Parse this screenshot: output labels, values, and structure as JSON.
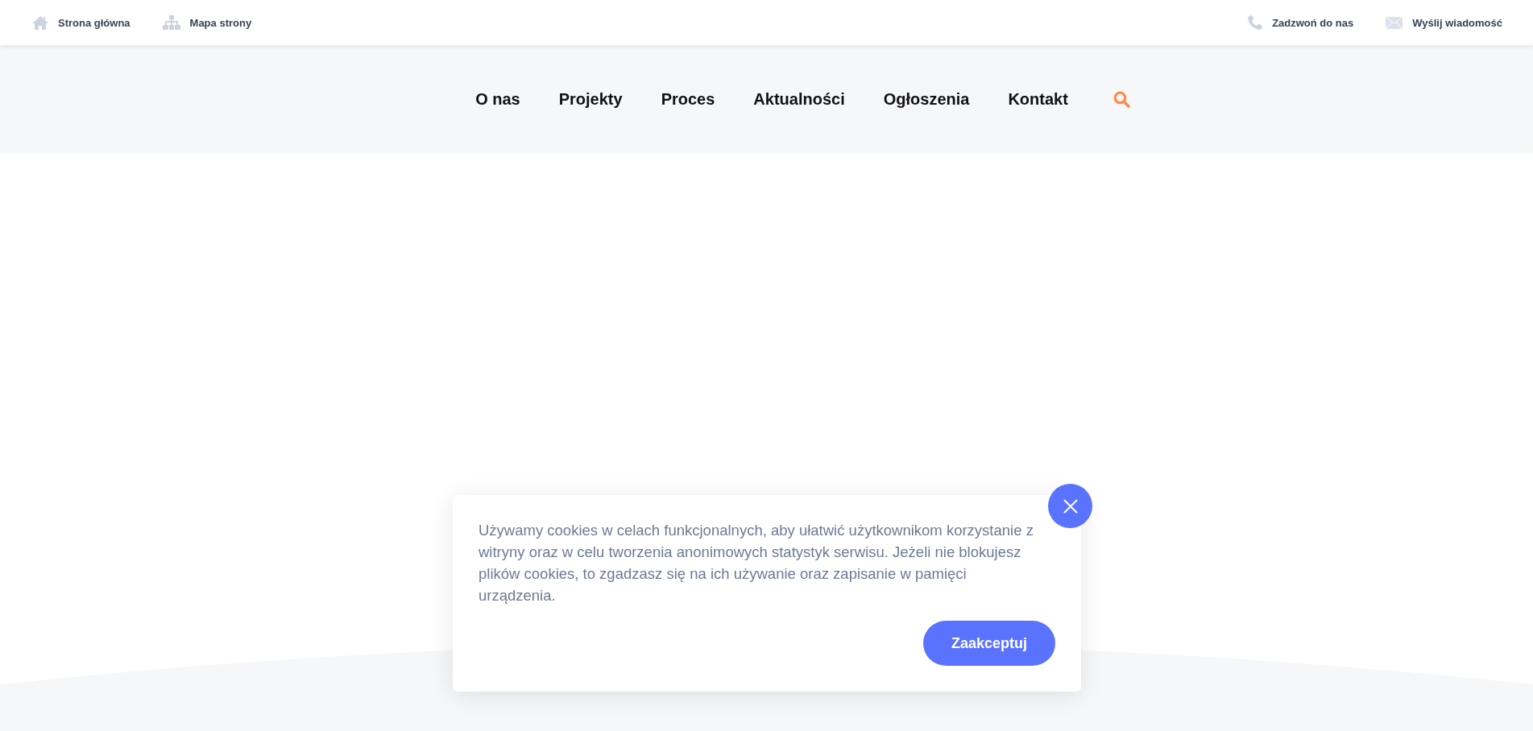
{
  "top_bar": {
    "left_links": [
      {
        "kind": "home",
        "label": "Strona główna"
      },
      {
        "kind": "sitemap",
        "label": "Mapa strony"
      }
    ],
    "right_links": [
      {
        "kind": "phone",
        "label": "Zadzwoń do nas"
      },
      {
        "kind": "mail",
        "label": "Wyślij wiadomość"
      }
    ]
  },
  "nav": {
    "items": [
      "O nas",
      "Projekty",
      "Proces",
      "Aktualności",
      "Ogłoszenia",
      "Kontakt"
    ]
  },
  "cookie_banner": {
    "text": "Używamy cookies w celach funkcjonalnych, aby ułatwić użytkownikom korzystanie z witryny oraz w celu tworzenia anonimowych statystyk serwisu. Jeżeli nie blokujesz plików cookies, to zgadzasz się na ich używanie oraz zapisanie w pamięci urządzenia.",
    "accept_button": "Zaakceptuj"
  }
}
